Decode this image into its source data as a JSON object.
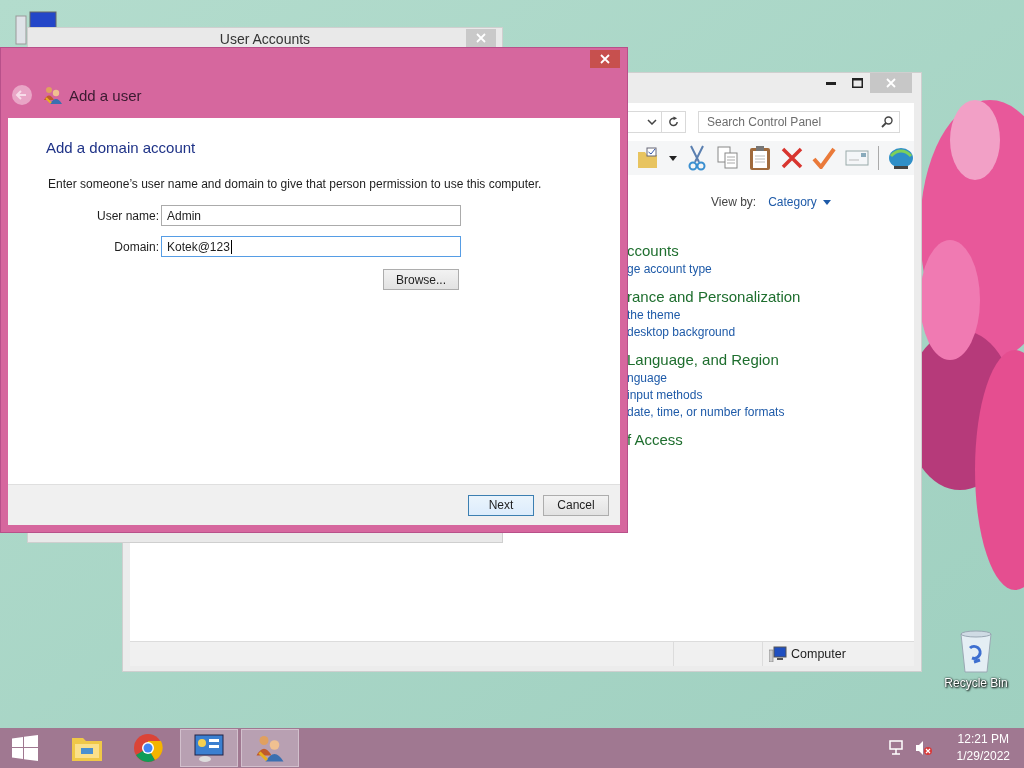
{
  "desktop": {
    "icons": [
      {
        "kind": "computer"
      },
      {
        "kind": "recycle-bin",
        "label": "Recycle Bin"
      }
    ]
  },
  "control_panel": {
    "search": {
      "placeholder": "Search Control Panel"
    },
    "view_by": {
      "label": "View by:",
      "value": "Category"
    },
    "categories": [
      {
        "heading": "ccounts",
        "links": [
          "ge account type"
        ]
      },
      {
        "heading": "rance and Personalization",
        "links": [
          "the theme",
          "desktop background"
        ]
      },
      {
        "heading": "Language, and Region",
        "links": [
          "nguage",
          "input methods",
          "date, time, or number formats"
        ]
      },
      {
        "heading": "f Access"
      }
    ],
    "status_bar": {
      "location": "Computer"
    }
  },
  "user_accounts": {
    "title": "User Accounts"
  },
  "dialog": {
    "title": "Add a user",
    "heading": "Add a domain account",
    "description": "Enter someone’s user name and domain to give that person permission to use this computer.",
    "fields": [
      {
        "label": "User name:",
        "value": "Admin",
        "focused": false
      },
      {
        "label": "Domain:",
        "value": "Kotek@123",
        "focused": true
      }
    ],
    "browse": "Browse...",
    "buttons": [
      {
        "label": "Next",
        "default": true
      },
      {
        "label": "Cancel",
        "default": false
      }
    ]
  },
  "taskbar": {
    "apps": [
      {
        "kind": "explorer",
        "active": false
      },
      {
        "kind": "browser",
        "active": false
      },
      {
        "kind": "control-panel",
        "active": true
      },
      {
        "kind": "user-accounts",
        "active": true
      }
    ],
    "clock": {
      "time": "12:21 PM",
      "date": "1/29/2022"
    }
  }
}
